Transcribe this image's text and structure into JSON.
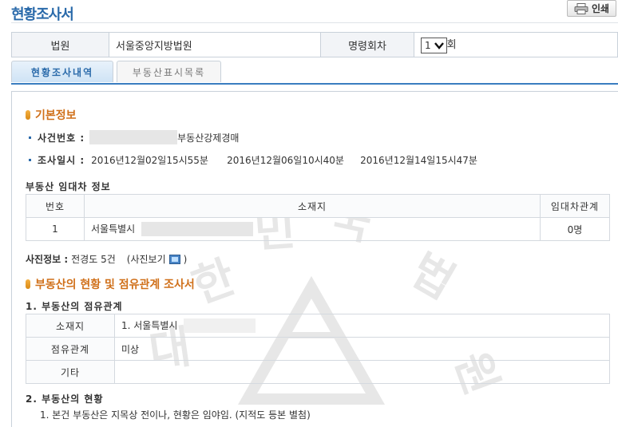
{
  "header": {
    "title": "현황조사서",
    "print_label": "인쇄"
  },
  "info": {
    "court_label": "법원",
    "court_value": "서울중앙지방법원",
    "order_label": "명령회차",
    "order_value": "1",
    "order_suffix": "회"
  },
  "tabs": [
    {
      "label": "현황조사내역"
    },
    {
      "label": "부동산표시목록"
    }
  ],
  "basic": {
    "title": "기본정보",
    "case_label": "사건번호 :",
    "case_suffix": "부동산강제경매",
    "date_label": "조사일시 :",
    "dates": [
      "2016년12월02일15시55분",
      "2016년12월06일10시40분",
      "2016년12월14일15시47분"
    ]
  },
  "lease": {
    "title": "부동산 임대차 정보",
    "headers": [
      "번호",
      "소재지",
      "임대차관계"
    ],
    "row": {
      "no": "1",
      "location": "서울특별시",
      "relation": "0명"
    }
  },
  "photo": {
    "label": "사진정보 :",
    "value": "전경도 5건",
    "view": "(사진보기",
    "close": ")"
  },
  "survey": {
    "title": "부동산의 현황 및 점유관계 조사서",
    "occupancy_title": "1. 부동산의 점유관계",
    "rows": [
      {
        "label": "소재지",
        "value": "1. 서울특별시"
      },
      {
        "label": "점유관계",
        "value": "미상"
      },
      {
        "label": "기타",
        "value": ""
      }
    ],
    "status_title": "2. 부동산의 현황",
    "status_line": "1. 본건 부동산은 지목상 전이나, 현황은 임야임. (지적도 등본 별첨)"
  },
  "watermark_text": [
    "대",
    "한",
    "민",
    "국",
    "법",
    "원"
  ]
}
